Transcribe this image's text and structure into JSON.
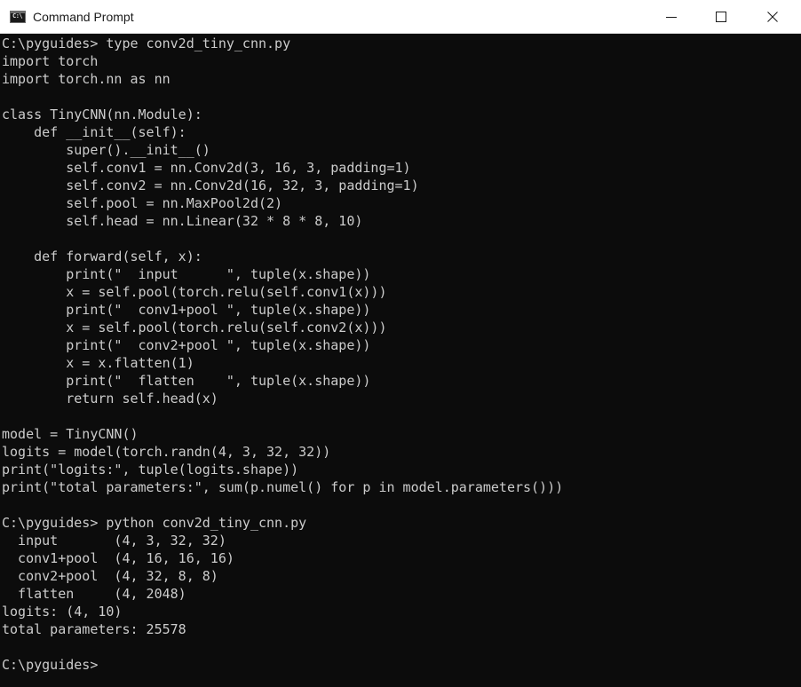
{
  "window": {
    "title": "Command Prompt",
    "icon": "cmd-icon",
    "icon_glyph": "C:\\",
    "controls": [
      "minimize-icon",
      "maximize-icon",
      "close-icon"
    ]
  },
  "colors": {
    "console_bg": "#0c0c0c",
    "console_fg": "#cccccc",
    "titlebar_bg": "#ffffff"
  },
  "console": {
    "lines": [
      "C:\\pyguides> type conv2d_tiny_cnn.py",
      "import torch",
      "import torch.nn as nn",
      "",
      "class TinyCNN(nn.Module):",
      "    def __init__(self):",
      "        super().__init__()",
      "        self.conv1 = nn.Conv2d(3, 16, 3, padding=1)",
      "        self.conv2 = nn.Conv2d(16, 32, 3, padding=1)",
      "        self.pool = nn.MaxPool2d(2)",
      "        self.head = nn.Linear(32 * 8 * 8, 10)",
      "",
      "    def forward(self, x):",
      "        print(\"  input      \", tuple(x.shape))",
      "        x = self.pool(torch.relu(self.conv1(x)))",
      "        print(\"  conv1+pool \", tuple(x.shape))",
      "        x = self.pool(torch.relu(self.conv2(x)))",
      "        print(\"  conv2+pool \", tuple(x.shape))",
      "        x = x.flatten(1)",
      "        print(\"  flatten    \", tuple(x.shape))",
      "        return self.head(x)",
      "",
      "model = TinyCNN()",
      "logits = model(torch.randn(4, 3, 32, 32))",
      "print(\"logits:\", tuple(logits.shape))",
      "print(\"total parameters:\", sum(p.numel() for p in model.parameters()))",
      "",
      "C:\\pyguides> python conv2d_tiny_cnn.py",
      "  input       (4, 3, 32, 32)",
      "  conv1+pool  (4, 16, 16, 16)",
      "  conv2+pool  (4, 32, 8, 8)",
      "  flatten     (4, 2048)",
      "logits: (4, 10)",
      "total parameters: 25578",
      "",
      "C:\\pyguides>"
    ]
  }
}
